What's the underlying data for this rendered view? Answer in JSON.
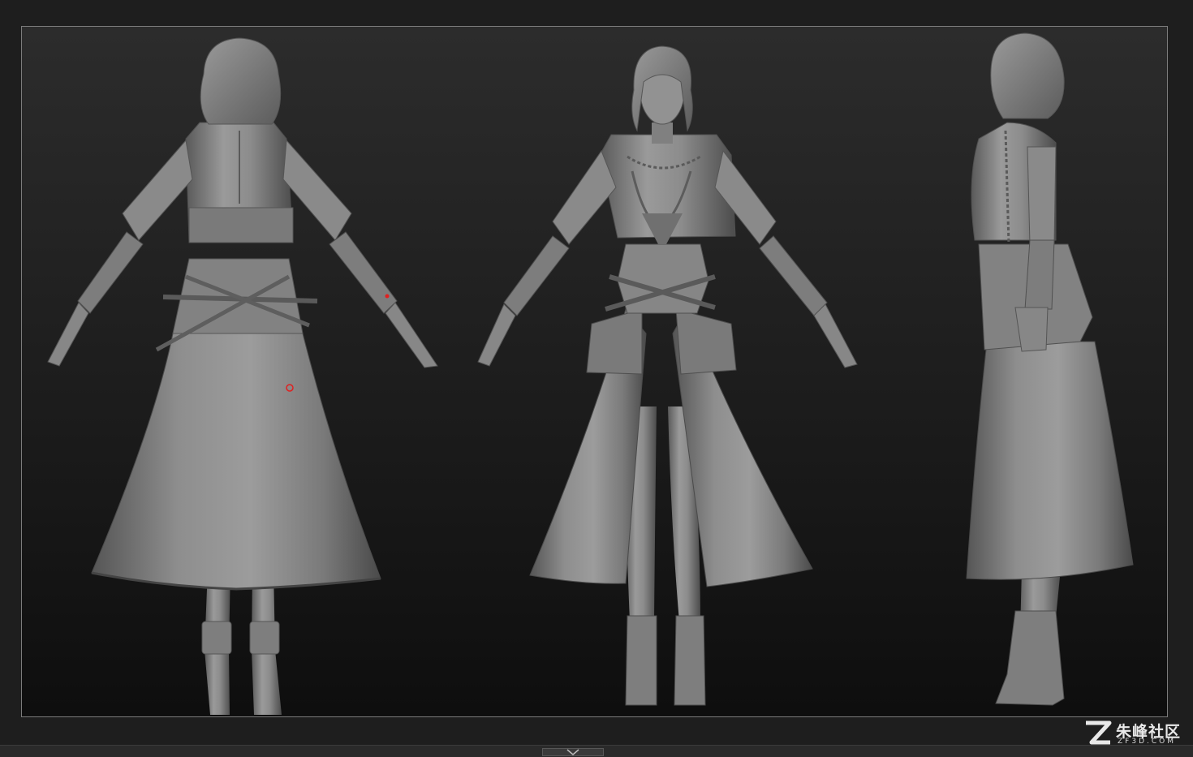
{
  "viewport": {
    "background": "#1c1c1c",
    "frame_color": "#7c7c7c",
    "model_color": "#8a8a8a",
    "views": [
      "back",
      "front",
      "side"
    ]
  },
  "markers": {
    "color": "#e02020"
  },
  "watermark": {
    "logo_icon": "zf3d-logo-icon",
    "name": "朱峰社区",
    "subtitle": "ZF3D.COM"
  },
  "bottom_bar": {
    "handle_icon": "chevron-down-icon"
  }
}
